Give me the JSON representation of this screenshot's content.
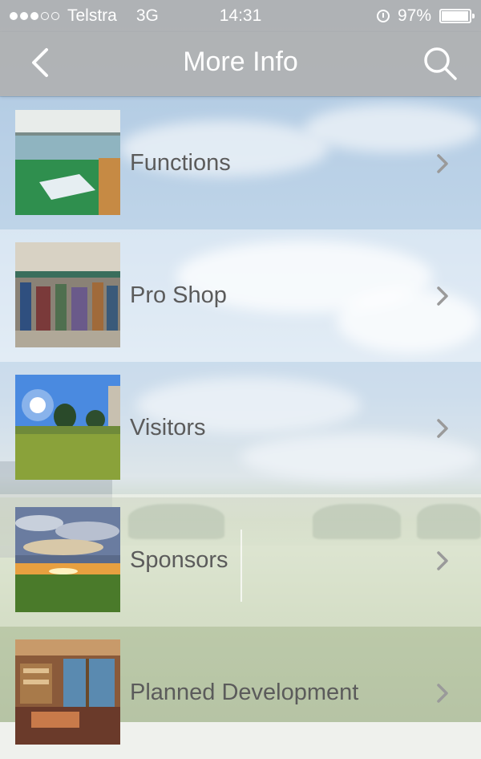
{
  "status_bar": {
    "carrier": "Telstra",
    "network": "3G",
    "time": "14:31",
    "battery": "97%",
    "battery_level": 0.97,
    "signal_bars_filled": 3,
    "signal_bars_total": 5
  },
  "nav": {
    "title": "More Info",
    "back_icon": "chevron-left-icon",
    "search_icon": "search-icon"
  },
  "menu": {
    "items": [
      {
        "label": "Functions",
        "thumb": "function-room-photo"
      },
      {
        "label": "Pro Shop",
        "thumb": "pro-shop-photo"
      },
      {
        "label": "Visitors",
        "thumb": "golf-course-photo"
      },
      {
        "label": "Sponsors",
        "thumb": "sunset-course-photo"
      },
      {
        "label": "Planned Development",
        "thumb": "clubhouse-interior-photo"
      }
    ]
  },
  "colors": {
    "bar_bg": "#b2b2b2",
    "label_text": "#5b5b5b",
    "chevron": "#9a9a9a"
  }
}
